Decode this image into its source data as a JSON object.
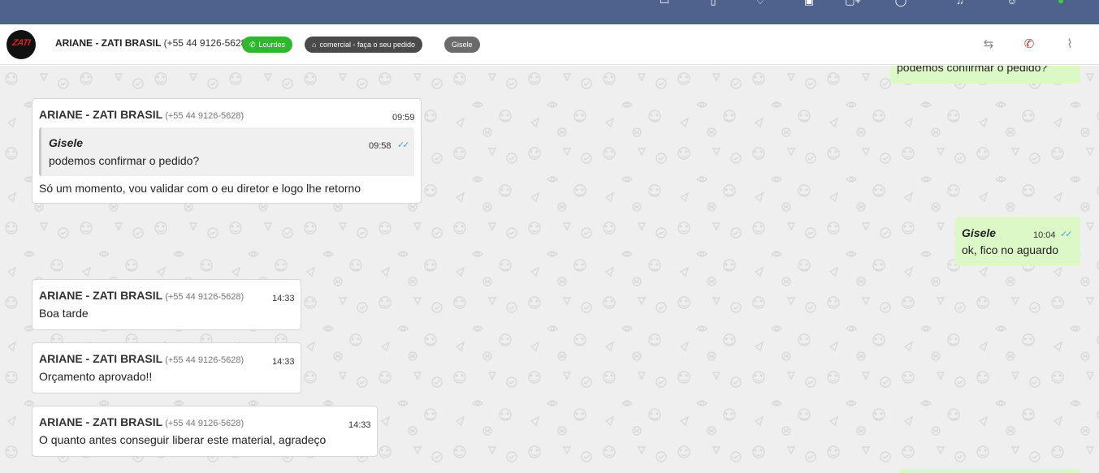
{
  "header": {
    "contact_name": "ARIANE - ZATI BRASIL",
    "contact_phone": "(+55 44 9126-5628)",
    "avatar_text": "ZATI",
    "tags": [
      {
        "label": "Lourdes",
        "icon": "whatsapp-icon"
      },
      {
        "label": "comercial - faça o seu pedido",
        "icon": "org-chart-icon"
      },
      {
        "label": "Gisele"
      }
    ]
  },
  "messages": [
    {
      "direction": "out",
      "text": "podemos confirmar o pedido?"
    },
    {
      "direction": "in",
      "sender": "ARIANE - ZATI BRASIL",
      "phone": "(+55 44 9126-5628)",
      "time": "09:59",
      "quote": {
        "sender": "Gisele",
        "time": "09:58",
        "text": "podemos confirmar o pedido?"
      },
      "text": "Só um momento, vou validar com o eu diretor e logo lhe retorno"
    },
    {
      "direction": "out",
      "sender": "Gisele",
      "time": "10:04",
      "text": "ok, fico no aguardo"
    },
    {
      "direction": "in",
      "sender": "ARIANE - ZATI BRASIL",
      "phone": "(+55 44 9126-5628)",
      "time": "14:33",
      "text": "Boa tarde"
    },
    {
      "direction": "in",
      "sender": "ARIANE - ZATI BRASIL",
      "phone": "(+55 44 9126-5628)",
      "time": "14:33",
      "text": "Orçamento aprovado!!"
    },
    {
      "direction": "in",
      "sender": "ARIANE - ZATI BRASIL",
      "phone": "(+55 44 9126-5628)",
      "time": "14:33",
      "text": "O quanto antes conseguir liberar este material, agradeço"
    }
  ],
  "colors": {
    "topbar": "#4f628e",
    "outgoing_bubble": "#dcf8c6",
    "incoming_bubble": "#ffffff",
    "tag_green": "#2eb82e",
    "tag_dark": "#4a4a4a",
    "tag_grey": "#6b6b6b",
    "call_icon": "#d0312d",
    "read_ticks": "#4fa3e0"
  }
}
